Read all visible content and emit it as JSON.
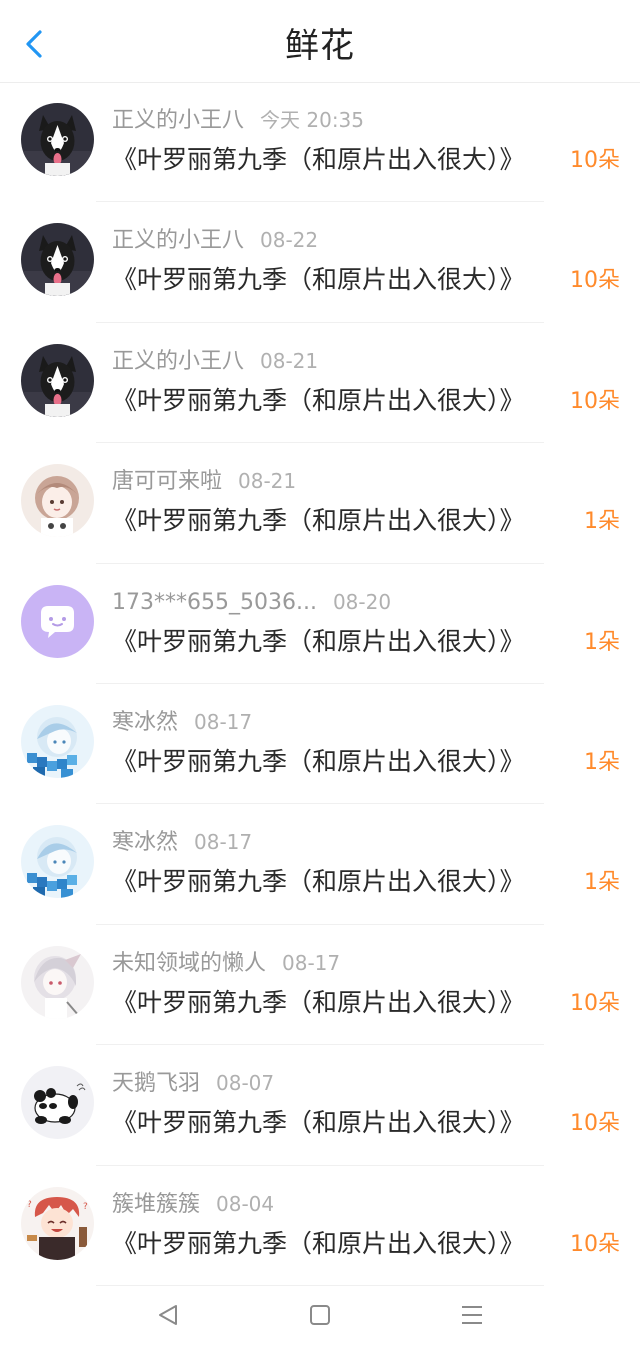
{
  "header": {
    "title": "鲜花",
    "back_icon": "chevron-left-icon"
  },
  "colors": {
    "accent": "#2196f3",
    "count": "#ff8a2b",
    "meta": "#999999"
  },
  "rows": [
    {
      "username": "正义的小王八",
      "date": "今天 20:35",
      "book": "《叶罗丽第九季（和原片出入很大）》",
      "count": "10朵",
      "avatar": "husky-avatar"
    },
    {
      "username": "正义的小王八",
      "date": "08-22",
      "book": "《叶罗丽第九季（和原片出入很大）》",
      "count": "10朵",
      "avatar": "husky-avatar"
    },
    {
      "username": "正义的小王八",
      "date": "08-21",
      "book": "《叶罗丽第九季（和原片出入很大）》",
      "count": "10朵",
      "avatar": "husky-avatar"
    },
    {
      "username": "唐可可来啦",
      "date": "08-21",
      "book": "《叶罗丽第九季（和原片出入很大）》",
      "count": "1朵",
      "avatar": "anime-girl-avatar"
    },
    {
      "username": "173***655_5036...",
      "date": "08-20",
      "book": "《叶罗丽第九季（和原片出入很大）》",
      "count": "1朵",
      "avatar": "chat-bubble-avatar"
    },
    {
      "username": "寒冰然",
      "date": "08-17",
      "book": "《叶罗丽第九季（和原片出入很大）》",
      "count": "1朵",
      "avatar": "blue-anime-avatar"
    },
    {
      "username": "寒冰然",
      "date": "08-17",
      "book": "《叶罗丽第九季（和原片出入很大）》",
      "count": "1朵",
      "avatar": "blue-anime-avatar"
    },
    {
      "username": "未知领域的懒人",
      "date": "08-17",
      "book": "《叶罗丽第九季（和原片出入很大）》",
      "count": "10朵",
      "avatar": "white-hair-avatar"
    },
    {
      "username": "天鹅飞羽",
      "date": "08-07",
      "book": "《叶罗丽第九季（和原片出入很大）》",
      "count": "10朵",
      "avatar": "panda-avatar"
    },
    {
      "username": "簇堆簇簇",
      "date": "08-04",
      "book": "《叶罗丽第九季（和原片出入很大）》",
      "count": "10朵",
      "avatar": "red-hair-boy-avatar"
    }
  ],
  "navbar": {
    "back_icon": "triangle-back-icon",
    "home_icon": "square-home-icon",
    "menu_icon": "menu-lines-icon"
  }
}
